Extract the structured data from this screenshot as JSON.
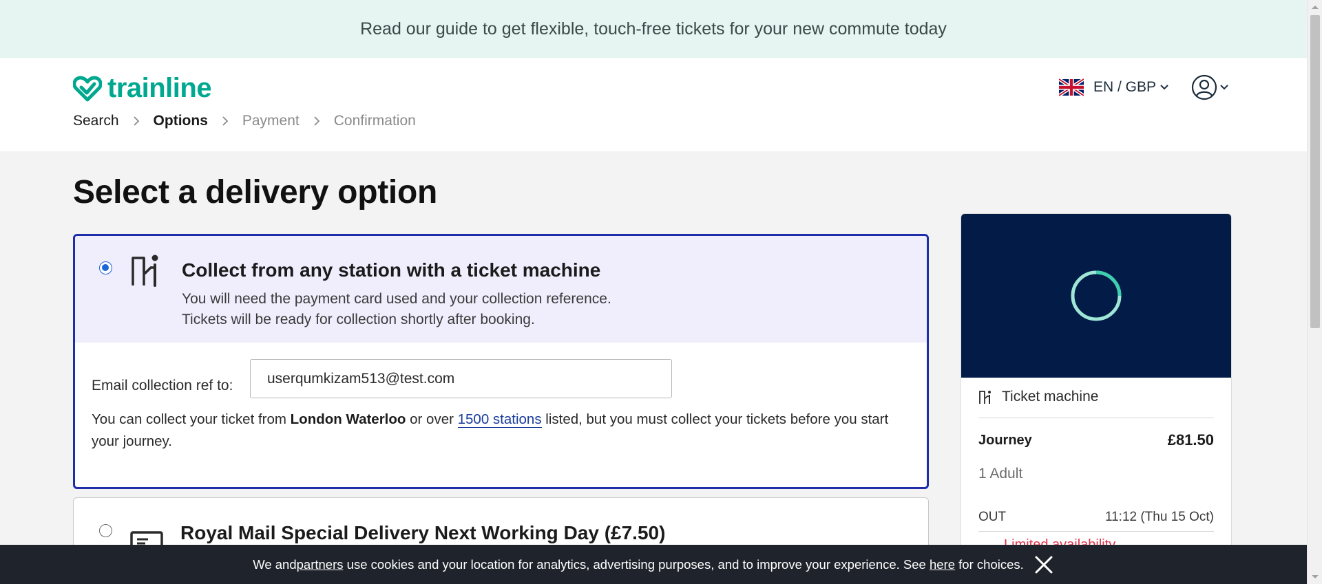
{
  "banner": {
    "text": "Read our guide to get flexible, touch-free tickets for your new commute today"
  },
  "header": {
    "logo_text": "trainline",
    "language_currency": "EN / GBP",
    "breadcrumb": [
      {
        "label": "Search",
        "state": "done"
      },
      {
        "label": "Options",
        "state": "active"
      },
      {
        "label": "Payment",
        "state": "upcoming"
      },
      {
        "label": "Confirmation",
        "state": "upcoming"
      }
    ]
  },
  "main": {
    "title": "Select a delivery option",
    "options": [
      {
        "selected": true,
        "icon": "ticket-machine-icon",
        "title": "Collect from any station with a ticket machine",
        "desc_line1": "You will need the payment card used and your collection reference.",
        "desc_line2": "Tickets will be ready for collection shortly after booking.",
        "email_label": "Email collection ref to:",
        "email_value": "userqumkizam513@test.com",
        "note_prefix": "You can collect your ticket from ",
        "note_station": "London Waterloo",
        "note_mid": " or over ",
        "note_link": "1500 stations",
        "note_suffix": " listed, but you must collect your tickets before you start your journey."
      },
      {
        "selected": false,
        "icon": "mail-icon",
        "title": "Royal Mail Special Delivery Next Working Day (£7.50)"
      }
    ]
  },
  "summary": {
    "delivery_method": "Ticket machine",
    "journey_label": "Journey",
    "journey_price": "£81.50",
    "passengers": "1 Adult",
    "out_label": "OUT",
    "out_time": "11:12 (Thu 15 Oct)",
    "availability": "Limited availability"
  },
  "cookie": {
    "text_1": "We and ",
    "partners": "partners",
    "text_2": " use cookies and your location for analytics, advertising purposes, and to improve your experience. See ",
    "here": "here",
    "text_3": " for choices."
  },
  "colors": {
    "brand": "#00a88f",
    "selected_border": "#1d2ea8",
    "summary_header": "#021b47",
    "warning": "#e0364b"
  }
}
